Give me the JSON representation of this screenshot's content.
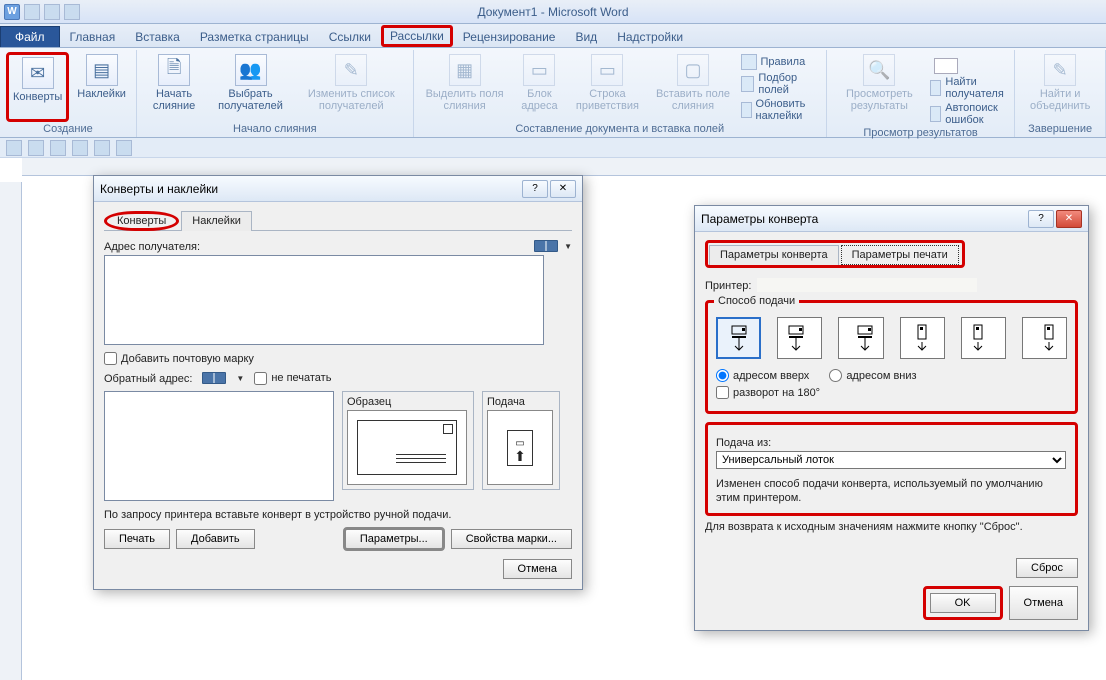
{
  "app_title": "Документ1 - Microsoft Word",
  "tabs": {
    "file": "Файл",
    "home": "Главная",
    "insert": "Вставка",
    "layout": "Разметка страницы",
    "references": "Ссылки",
    "mailings": "Рассылки",
    "review": "Рецензирование",
    "view": "Вид",
    "addins": "Надстройки"
  },
  "ribbon": {
    "create": {
      "label": "Создание",
      "envelopes": "Конверты",
      "labels": "Наклейки"
    },
    "start_merge": {
      "label": "Начало слияния",
      "start": "Начать слияние",
      "select": "Выбрать получателей",
      "edit": "Изменить список получателей"
    },
    "write_insert": {
      "label": "Составление документа и вставка полей",
      "highlight": "Выделить поля слияния",
      "address": "Блок адреса",
      "greeting": "Строка приветствия",
      "field": "Вставить поле слияния"
    },
    "rules": {
      "rules": "Правила",
      "match": "Подбор полей",
      "update": "Обновить наклейки"
    },
    "preview": {
      "label": "Просмотр результатов",
      "preview": "Просмотреть результаты",
      "find": "Найти получателя",
      "auto": "Автопоиск ошибок"
    },
    "finish": {
      "label": "Завершение",
      "finish": "Найти и объединить"
    }
  },
  "dlg_env": {
    "title": "Конверты и наклейки",
    "tab_envelopes": "Конверты",
    "tab_labels": "Наклейки",
    "recipient": "Адрес получателя:",
    "add_postage": "Добавить почтовую марку",
    "return_addr": "Обратный адрес:",
    "no_print": "не печатать",
    "sample": "Образец",
    "feed": "Подача",
    "hint": "По запросу принтера вставьте конверт в устройство ручной подачи.",
    "print": "Печать",
    "add": "Добавить",
    "params": "Параметры...",
    "stamp_props": "Свойства марки...",
    "cancel": "Отмена"
  },
  "dlg_opts": {
    "title": "Параметры конверта",
    "tab_env": "Параметры конверта",
    "tab_print": "Параметры  печати",
    "printer": "Принтер:",
    "feed_method": "Способ подачи",
    "addr_up": "адресом вверх",
    "addr_down": "адресом вниз",
    "rotate180": "разворот на 180°",
    "feed_from": "Подача из:",
    "tray": "Универсальный лоток",
    "changed": "Изменен способ подачи конверта, используемый по умолчанию этим принтером.",
    "reset_hint": "Для возврата к исходным значениям нажмите кнопку \"Сброс\".",
    "reset": "Сброс",
    "ok": "OK",
    "cancel": "Отмена"
  }
}
